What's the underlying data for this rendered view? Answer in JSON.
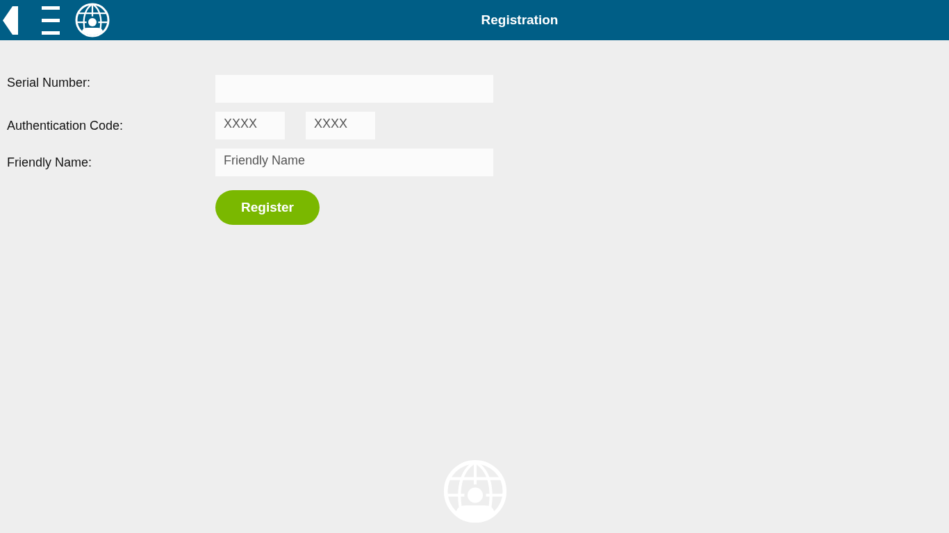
{
  "header": {
    "title": "Registration"
  },
  "form": {
    "fields": [
      {
        "label": "Serial Number:",
        "inputs": [
          {
            "kind": "wide"
          }
        ]
      },
      {
        "label": "Authentication Code:",
        "inputs": [
          {
            "kind": "short",
            "placeholder": "XXXX"
          },
          {
            "kind": "short",
            "placeholder": "XXXX"
          }
        ]
      },
      {
        "label": "Friendly Name:",
        "inputs": [
          {
            "kind": "wide",
            "placeholder": "Friendly Name"
          }
        ]
      }
    ],
    "submit": {
      "label": "Register"
    }
  }
}
